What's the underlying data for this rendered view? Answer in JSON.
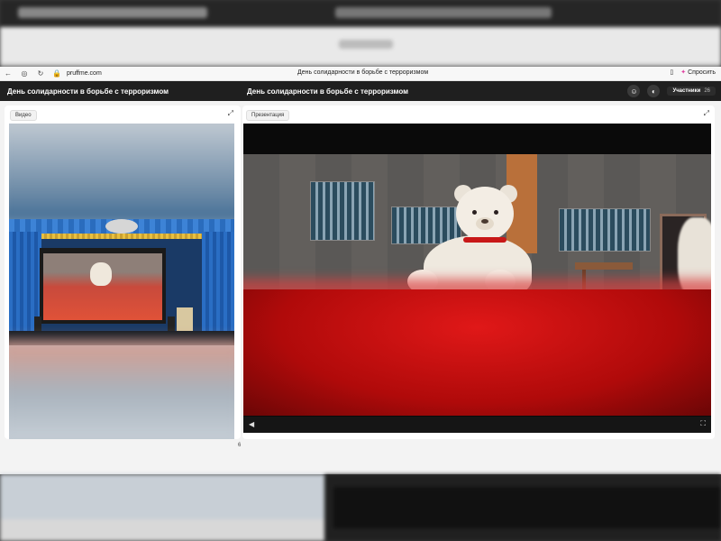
{
  "browser": {
    "url": "pruffme.com",
    "tab_title": "День солидарности в борьбе с терроризмом",
    "ask_label": "Спросить"
  },
  "header": {
    "left_title": "День солидарности в борьбе с терроризмом",
    "right_title": "День солидарности в борьбе с терроризмом",
    "participants_label": "Участники",
    "participants_count": "26"
  },
  "video_panel": {
    "label": "Видео",
    "corner_number": "6"
  },
  "presentation_panel": {
    "label": "Презентация"
  },
  "icons": {
    "back": "back-arrow-icon",
    "home": "home-icon",
    "reload": "reload-icon",
    "lock": "lock-icon",
    "bookmark": "bookmark-icon",
    "emoji": "emoji-icon",
    "chat": "chat-icon",
    "expand": "expand-icon",
    "play": "play-icon",
    "fullscreen": "fullscreen-icon"
  },
  "colors": {
    "header_bg": "#1f1f1f",
    "accent": "#e040a0"
  }
}
